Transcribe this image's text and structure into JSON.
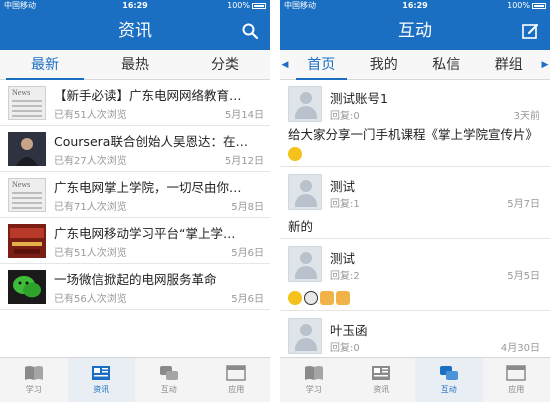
{
  "status": {
    "carrier": "中国移动",
    "time": "16:29",
    "battery": "100%"
  },
  "left": {
    "title": "资讯",
    "tabs": [
      {
        "label": "最新"
      },
      {
        "label": "最热"
      },
      {
        "label": "分类"
      }
    ],
    "news": [
      {
        "title": "【新手必读】广东电网网络教育…",
        "meta": "已有51人次浏览",
        "date": "5月14日",
        "thumb": "news"
      },
      {
        "title": "Coursera联合创始人吴恩达：在…",
        "meta": "已有27人次浏览",
        "date": "5月12日",
        "thumb": "person"
      },
      {
        "title": "广东电网掌上学院，一切尽由你…",
        "meta": "已有71人次浏览",
        "date": "5月8日",
        "thumb": "news"
      },
      {
        "title": "广东电网移动学习平台“掌上学…",
        "meta": "已有51人次浏览",
        "date": "5月6日",
        "thumb": "photo"
      },
      {
        "title": "一场微信掀起的电网服务革命",
        "meta": "已有56人次浏览",
        "date": "5月6日",
        "thumb": "wechat"
      }
    ],
    "tabbar": [
      {
        "label": "学习"
      },
      {
        "label": "资讯"
      },
      {
        "label": "互动"
      },
      {
        "label": "应用"
      }
    ]
  },
  "right": {
    "title": "互动",
    "tabs": [
      {
        "label": "首页"
      },
      {
        "label": "我的"
      },
      {
        "label": "私信"
      },
      {
        "label": "群组"
      }
    ],
    "posts": [
      {
        "name": "测试账号1",
        "reply": "回复:0",
        "date": "3天前",
        "content": "给大家分享一门手机课程《掌上学院宣传片》"
      },
      {
        "name": "测试",
        "reply": "回复:1",
        "date": "5月7日",
        "content": "新的"
      },
      {
        "name": "测试",
        "reply": "回复:2",
        "date": "5月5日",
        "content": ""
      },
      {
        "name": "叶玉函",
        "reply": "回复:0",
        "date": "4月30日",
        "content": ""
      }
    ],
    "tabbar": [
      {
        "label": "学习"
      },
      {
        "label": "资讯"
      },
      {
        "label": "互动"
      },
      {
        "label": "应用"
      }
    ]
  },
  "colors": {
    "accent": "#1b6fc2"
  }
}
